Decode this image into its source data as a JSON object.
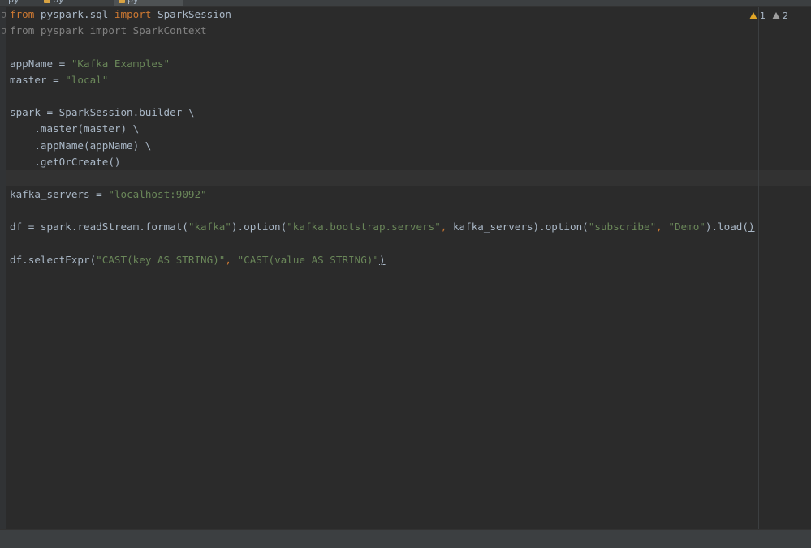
{
  "tabs": [
    {
      "label": "py",
      "active": false
    },
    {
      "label": "py",
      "active": false
    },
    {
      "label": "py",
      "active": true
    }
  ],
  "inspections": {
    "warnings": "1",
    "weak_warnings": "2",
    "warning_icon": "warning-triangle-icon",
    "weak_warning_icon": "weak-warning-triangle-icon"
  },
  "colors": {
    "background": "#2b2b2b",
    "keyword": "#cc7832",
    "string": "#6a8759",
    "text": "#a9b7c6",
    "unused_import": "#808080",
    "warning": "#e0a526"
  },
  "code": {
    "line1": {
      "kw1": "from",
      "t1": " pyspark.sql ",
      "kw2": "import",
      "t2": " SparkSession"
    },
    "line2": {
      "text": "from pyspark import SparkContext"
    },
    "line4": {
      "t1": "appName = ",
      "s1": "\"Kafka Examples\""
    },
    "line5": {
      "t1": "master = ",
      "s1": "\"local\""
    },
    "line7": {
      "text": "spark = SparkSession.builder \\"
    },
    "line8": {
      "text": "    .master(master) \\"
    },
    "line9": {
      "text": "    .appName(appName) \\"
    },
    "line10": {
      "text": "    .getOrCreate()"
    },
    "line12": {
      "t1": "kafka_servers = ",
      "s1": "\"localhost:9092\""
    },
    "line14": {
      "t1": "df = spark.readStream.format(",
      "s1": "\"kafka\"",
      "t2": ").option(",
      "s2": "\"kafka.bootstrap.servers\"",
      "k1": ",",
      "t3": " kafka_servers).option(",
      "s3": "\"subscribe\"",
      "k2": ",",
      "t4": " ",
      "s4": "\"Demo\"",
      "t5": ").load(",
      "t6": ")"
    },
    "line16": {
      "t1": "df.selectExpr(",
      "s1": "\"CAST(key AS STRING)\"",
      "k1": ",",
      "t2": " ",
      "s2": "\"CAST(value AS STRING)\"",
      "t3": ")"
    }
  }
}
